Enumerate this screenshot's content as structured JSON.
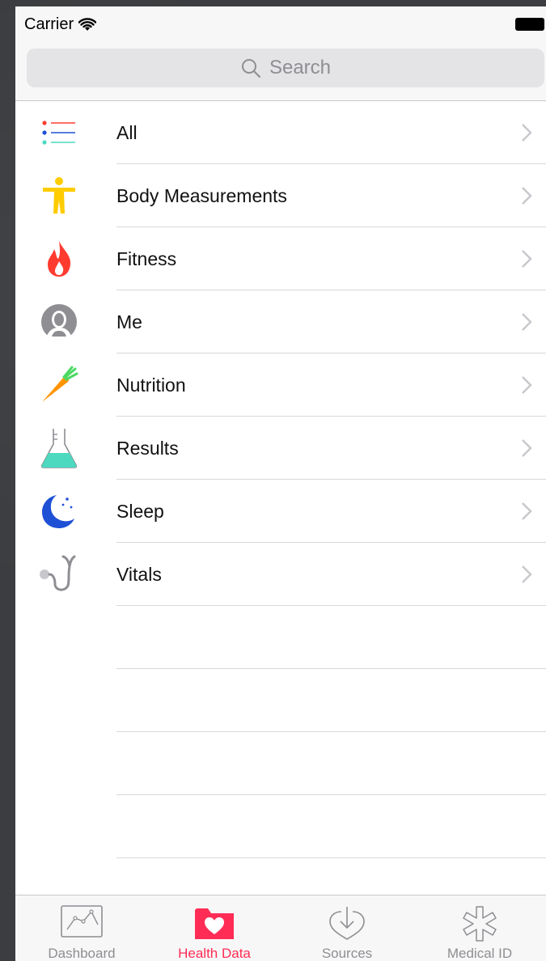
{
  "status_bar": {
    "carrier": "Carrier"
  },
  "search": {
    "placeholder": "Search"
  },
  "categories": [
    {
      "label": "All",
      "icon": "list-icon"
    },
    {
      "label": "Body Measurements",
      "icon": "body-figure-icon"
    },
    {
      "label": "Fitness",
      "icon": "flame-icon"
    },
    {
      "label": "Me",
      "icon": "person-icon"
    },
    {
      "label": "Nutrition",
      "icon": "carrot-icon"
    },
    {
      "label": "Results",
      "icon": "flask-icon"
    },
    {
      "label": "Sleep",
      "icon": "moon-icon"
    },
    {
      "label": "Vitals",
      "icon": "stethoscope-icon"
    }
  ],
  "tabs": [
    {
      "label": "Dashboard",
      "icon": "dashboard-icon",
      "active": false
    },
    {
      "label": "Health Data",
      "icon": "health-data-folder-icon",
      "active": true
    },
    {
      "label": "Sources",
      "icon": "sources-download-icon",
      "active": false
    },
    {
      "label": "Medical ID",
      "icon": "medical-id-icon",
      "active": false
    }
  ],
  "colors": {
    "accent": "#ff2d55",
    "fitness": "#ff3b30",
    "body": "#ffcc00",
    "nutrition": "#ff9500",
    "results": "#4cd9c0",
    "sleep": "#1e50d6",
    "vitals": "#8e8e93"
  }
}
